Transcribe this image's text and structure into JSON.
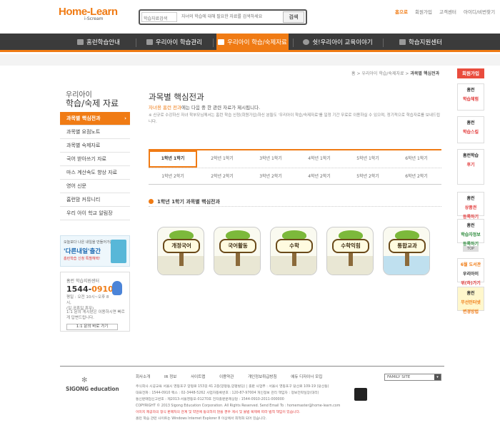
{
  "header": {
    "logo_main": "Home-Learn",
    "logo_sub": "i-Scream",
    "search": {
      "category": "학습자료검색",
      "placeholder": "자녀의 학습에 대해 필요한 자료를 검색하세요",
      "button": "검색"
    },
    "top_links": [
      "홈으로",
      "회원가입",
      "고객센터",
      "아이디/비번찾기"
    ]
  },
  "nav": {
    "items": [
      {
        "label": "홈런학습안내",
        "active": false
      },
      {
        "label": "우리아이 학습관리",
        "active": false
      },
      {
        "label": "우리아이 학습/숙제자료",
        "active": true
      },
      {
        "label": "쉿!우리아이 교육이야기",
        "active": false
      },
      {
        "label": "학습지원센터",
        "active": false
      }
    ]
  },
  "breadcrumb": {
    "items": [
      "홈",
      "우리아이 학습/숙제자료"
    ],
    "current": "과목별 핵심전과"
  },
  "sidebar": {
    "title_line1": "우리아이",
    "title_line2": "학습/숙제 자료",
    "items": [
      {
        "label": "과목별 핵심전과",
        "active": true
      },
      {
        "label": "과목별 요점노트",
        "active": false
      },
      {
        "label": "과목별 숙제자료",
        "active": false
      },
      {
        "label": "국어 받아쓰기 자료",
        "active": false
      },
      {
        "label": "마스 계산속도 향상 자료",
        "active": false
      },
      {
        "label": "영어 신문",
        "active": false
      },
      {
        "label": "홈런맘 커뮤니티",
        "active": false
      },
      {
        "label": "우리 아이 학교 알림장",
        "active": false
      }
    ],
    "banner": {
      "line1": "오늘보다 나은 내일을 만들어가는",
      "line2": "'다른내일'출간",
      "line3": "홈런학습 신청 특별혜택!"
    },
    "cs": {
      "label": "홈런 학습지원센터",
      "phone_prefix": "1544-",
      "phone_suffix": "0910",
      "hours": "평일 : 오전 10시~오후 8시,",
      "holiday": "(일,공휴일 휴무)",
      "note": "1:1 문의 게시판은 이용하시면 빠르게 답변드립니다.",
      "button": "1:1 문의 바로 가기"
    }
  },
  "main": {
    "title": "과목별 핵심전과",
    "desc_highlight": "자녀용 홈런 전과",
    "desc_rest": "에는 다음 중 한 관련 자료가 제시됩니다.",
    "note": "※ 신규로 수강하신 자녀 학부모님께서는 홈런 학습 신청(회원가입)하신 분들도 '우리아이 학습/숙제자료'를 일정 기간 무료로 이용하실 수 있으며, 정기적으로 학습자료를 보내드립니다.",
    "grade_tabs": {
      "row1": [
        "1학년 1학기",
        "2학년 1학기",
        "3학년 1학기",
        "4학년 1학기",
        "5학년 1학기",
        "6학년 1학기"
      ],
      "row2": [
        "1학년 2학기",
        "2학년 2학기",
        "3학년 2학기",
        "4학년 2학기",
        "5학년 2학기",
        "6학년 2학기"
      ],
      "selected": "1학년 1학기"
    },
    "section_title": "1학년 1학기 과목별 핵심전과",
    "subjects": [
      "개정국어",
      "국어활동",
      "수학",
      "수학익힘",
      "통합교과"
    ]
  },
  "right_rail": {
    "header": "회원가입",
    "boxes": [
      {
        "l1": "홈런",
        "l2": "학습체험"
      },
      {
        "l1": "홈런",
        "l2": "학습스킬"
      },
      {
        "l1": "홈런학습",
        "l2": "후기"
      },
      {
        "l1": "홈런",
        "l2": "상품권",
        "l3": "등록하기"
      },
      {
        "l1": "홈런",
        "l2": "학습자정보",
        "l3": "등록하기"
      },
      {
        "l1": "6월 도서관",
        "l2": "우리아이",
        "l3": "위(하)가기"
      },
      {
        "l1": "홈런",
        "l2": "무선인터넷",
        "l3": "변경방법"
      }
    ],
    "top": "TOP"
  },
  "footer": {
    "brand": "SIGONG education",
    "links": [
      "회사소개",
      "IR 정보",
      "사이트맵",
      "이용약관",
      "개인정보취급방침",
      "에듀 디자이너 모집"
    ],
    "family_site": "FAMILY SITE",
    "info1": "주식회사 시공교육 서울시 영등포구 양평로 153길 41 2층(양평동,양평빌딩) | 출판 사업부 : 서울시 영등포구 당산로 109-19 (당산동)",
    "info2": "대표전화 : 1544-0910  팩스 : 02-3448-5262  사업자등록번호 : 120-87-97004  개인정보 관리 책임자 : 정보전략실장(대리)",
    "info3": "통신판매업신고번호 : 제2013-서울영등포-01270호  전자출판문제상담 : 1544-0910-2011-000000",
    "copyright": "COPYRIGHT © 2013 Sigong Education Corporation. All Rights Reserved. Send Email To : homemaster@home-learn.com",
    "notice_em": "이미지 제공자의 정식 판매처의 관계 및 약관에 동의하지 않을 경우 게시 및 불법 복제에 따라 법적 책임이 있습니다.",
    "notice2": "홈런 학습 관련 사이트는 Windows Internet Explorer 8 이상에서 최적화 되어 있습니다."
  }
}
